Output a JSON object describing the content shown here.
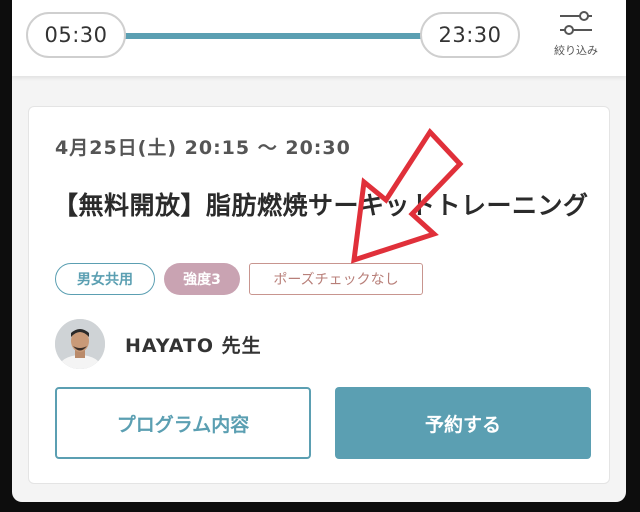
{
  "time_filter": {
    "start_time": "05:30",
    "end_time": "23:30",
    "filter_label": "絞り込み",
    "track_color": "#5b9fb2"
  },
  "lesson": {
    "datetime": "4月25日(土) 20:15 〜 20:30",
    "title": "【無料開放】脂肪燃焼サーキットトレーニング",
    "tags": {
      "gender": "男女共用",
      "intensity": "強度3",
      "pose_check": "ポーズチェックなし"
    },
    "instructor": {
      "name": "HAYATO 先生"
    },
    "buttons": {
      "program": "プログラム内容",
      "reserve": "予約する"
    }
  },
  "colors": {
    "accent": "#5b9fb2",
    "intensity_tag": "#c9a3b2",
    "pose_tag": "#c8958f",
    "annotation_arrow": "#e0303a"
  },
  "icons": {
    "filter": "sliders-icon",
    "annotation": "red-arrow-annotation"
  }
}
